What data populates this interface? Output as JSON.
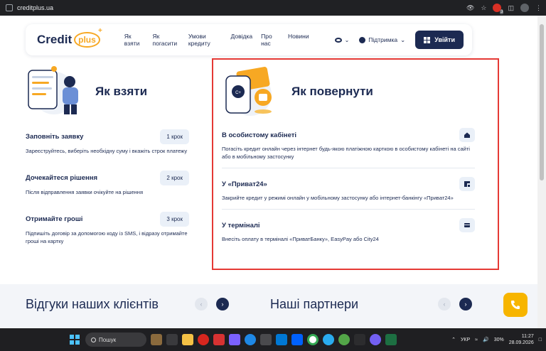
{
  "browser": {
    "url": "creditplus.ua",
    "badge_count": "3"
  },
  "header": {
    "logo_text": "Credit",
    "logo_plus": "plus",
    "nav": [
      "Як взяти",
      "Як погасити",
      "Умови кредиту",
      "Довідка",
      "Про нас",
      "Новини"
    ],
    "support_label": "Підтримка",
    "login_label": "Увійти"
  },
  "how_to_get": {
    "title": "Як взяти",
    "steps": [
      {
        "title": "Заповніть заявку",
        "badge": "1 крок",
        "text": "Зареєструйтесь, виберіть необхідну суму і вкажіть строк платежу"
      },
      {
        "title": "Дочекайтеся рішення",
        "badge": "2 крок",
        "text": "Після відправлення заявки очікуйте на рішення"
      },
      {
        "title": "Отримайте гроші",
        "badge": "3 крок",
        "text": "Підпишіть договір за допомогою коду із SMS, і відразу отримайте гроші на картку"
      }
    ]
  },
  "how_to_repay": {
    "title": "Як повернути",
    "items": [
      {
        "title": "В особистому кабінеті",
        "icon": "home-icon",
        "text": "Погасіть кредит онлайн через інтернет будь-якою платіжною карткою в особистому кабінеті на сайті або в мобільному застосунку"
      },
      {
        "title": "У «Приват24»",
        "icon": "privat24-icon",
        "text": "Закрийте кредит у режимі онлайн у мобільному застосунку або інтернет-банкінгу «Приват24»"
      },
      {
        "title": "У терміналі",
        "icon": "wallet-icon",
        "text": "Внесіть оплату в терміналі «ПриватБанку», EasyPay або City24"
      }
    ]
  },
  "reviews": {
    "title": "Відгуки наших клієнтів"
  },
  "partners": {
    "title": "Наші партнери"
  },
  "taskbar": {
    "search_label": "Пошук",
    "lang": "УКР",
    "battery": "30%",
    "time": "11:27",
    "date": "28.09.2026"
  },
  "colors": {
    "brand_navy": "#1c2a52",
    "brand_orange": "#f7a823",
    "call_yellow": "#f7b500",
    "highlight_red": "#e53935"
  }
}
